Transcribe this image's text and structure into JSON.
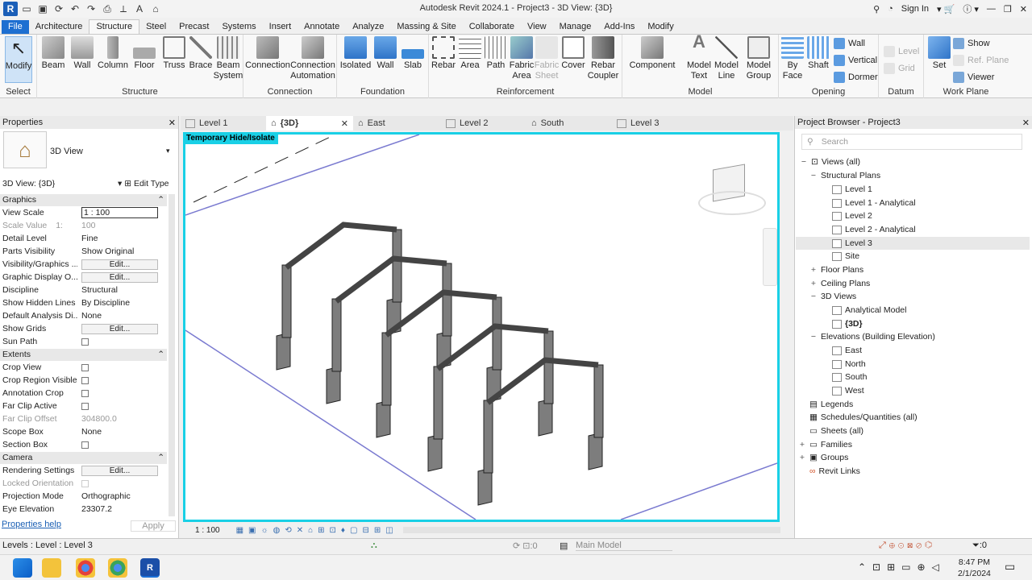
{
  "window": {
    "title": "Autodesk Revit 2024.1 - Project3 - 3D View: {3D}",
    "sign_in": "Sign In"
  },
  "ribbon_tabs": [
    "File",
    "Architecture",
    "Structure",
    "Steel",
    "Precast",
    "Systems",
    "Insert",
    "Annotate",
    "Analyze",
    "Massing & Site",
    "Collaborate",
    "View",
    "Manage",
    "Add-Ins",
    "Modify"
  ],
  "ribbon": {
    "select": {
      "label": "Select",
      "buttons": [
        "Modify"
      ]
    },
    "structure": {
      "label": "Structure",
      "buttons": [
        "Beam",
        "Wall",
        "Column",
        "Floor",
        "Truss",
        "Brace",
        "Beam System"
      ]
    },
    "connection": {
      "label": "Connection",
      "buttons": [
        "Connection",
        "Connection Automation"
      ]
    },
    "foundation": {
      "label": "Foundation",
      "buttons": [
        "Isolated",
        "Wall",
        "Slab"
      ]
    },
    "reinforcement": {
      "label": "Reinforcement",
      "buttons": [
        "Rebar",
        "Area",
        "Path",
        "Fabric Area",
        "Fabric Sheet",
        "Cover",
        "Rebar Coupler"
      ]
    },
    "model": {
      "label": "Model",
      "buttons": [
        "Component",
        "Model Text",
        "Model Line",
        "Model Group"
      ]
    },
    "opening": {
      "label": "Opening",
      "buttons": [
        "By Face",
        "Shaft",
        "Wall",
        "Vertical",
        "Dormer"
      ]
    },
    "datum": {
      "label": "Datum",
      "buttons": [
        "Level",
        "Grid"
      ]
    },
    "workplane": {
      "label": "Work Plane",
      "buttons": [
        "Set",
        "Show",
        "Ref. Plane",
        "Viewer"
      ]
    }
  },
  "properties": {
    "title": "Properties",
    "type_name": "3D View",
    "instance": "3D View: {3D}",
    "edit_type": "Edit Type",
    "sections": {
      "graphics": "Graphics",
      "extents": "Extents",
      "camera": "Camera"
    },
    "rows": [
      {
        "k": "View Scale",
        "v": "1 : 100"
      },
      {
        "k": "Scale Value",
        "v": "1:",
        "v2": "100"
      },
      {
        "k": "Detail Level",
        "v": "Fine"
      },
      {
        "k": "Parts Visibility",
        "v": "Show Original"
      },
      {
        "k": "Visibility/Graphics ...",
        "v": "Edit..."
      },
      {
        "k": "Graphic Display O...",
        "v": "Edit..."
      },
      {
        "k": "Discipline",
        "v": "Structural"
      },
      {
        "k": "Show Hidden Lines",
        "v": "By Discipline"
      },
      {
        "k": "Default Analysis Di...",
        "v": "None"
      },
      {
        "k": "Show Grids",
        "v": "Edit..."
      },
      {
        "k": "Sun Path",
        "v": ""
      },
      {
        "k": "Crop View",
        "v": ""
      },
      {
        "k": "Crop Region Visible",
        "v": ""
      },
      {
        "k": "Annotation Crop",
        "v": ""
      },
      {
        "k": "Far Clip Active",
        "v": ""
      },
      {
        "k": "Far Clip Offset",
        "v": "304800.0"
      },
      {
        "k": "Scope Box",
        "v": "None"
      },
      {
        "k": "Section Box",
        "v": ""
      },
      {
        "k": "Rendering Settings",
        "v": "Edit..."
      },
      {
        "k": "Locked Orientation",
        "v": ""
      },
      {
        "k": "Projection Mode",
        "v": "Orthographic"
      },
      {
        "k": "Eye Elevation",
        "v": "23307.2"
      }
    ],
    "help": "Properties help",
    "apply": "Apply"
  },
  "view_tabs": [
    "Level 1",
    "{3D}",
    "East",
    "Level 2",
    "South",
    "Level 3"
  ],
  "canvas": {
    "badge": "Temporary Hide/Isolate",
    "scale": "1 : 100"
  },
  "browser": {
    "title": "Project Browser - Project3",
    "search": "Search",
    "nodes": [
      "Views (all)",
      "Structural Plans",
      "Level 1",
      "Level 1 - Analytical",
      "Level 2",
      "Level 2 - Analytical",
      "Level 3",
      "Site",
      "Floor Plans",
      "Ceiling Plans",
      "3D Views",
      "Analytical Model",
      "{3D}",
      "Elevations (Building Elevation)",
      "East",
      "North",
      "South",
      "West",
      "Legends",
      "Schedules/Quantities (all)",
      "Sheets (all)",
      "Families",
      "Groups",
      "Revit Links"
    ]
  },
  "status": {
    "left": "Levels : Level : Level 3",
    "model": "Main Model",
    "filter": ":0",
    "sel": ":0"
  },
  "taskbar": {
    "time": "8:47 PM",
    "date": "2/1/2024"
  }
}
